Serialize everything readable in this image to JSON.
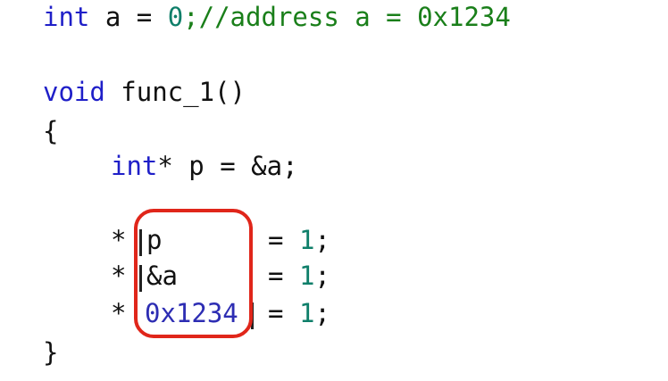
{
  "code": {
    "line1": {
      "kw": "int",
      "rest": " a = ",
      "num": "0",
      "semi": ";",
      "comment": "//address a = 0x1234"
    },
    "line2": {
      "kw": "void",
      "rest": " func_1()"
    },
    "line3": {
      "text": "{"
    },
    "line4": {
      "kw": "int",
      "rest": "* p = &a;"
    },
    "line5": {
      "star": "*",
      "operand": "p",
      "eq": "=",
      "num": "1",
      "semi": ";"
    },
    "line6": {
      "star": "*",
      "operand": "&a",
      "eq": "=",
      "num": "1",
      "semi": ";"
    },
    "line7": {
      "star": "*",
      "operand": "0x1234",
      "eq": "=",
      "num": "1",
      "semi": ";"
    },
    "line8": {
      "text": "}"
    }
  },
  "colors": {
    "keyword": "#1f1fc8",
    "number": "#0f7f6a",
    "comment": "#1a7f1a",
    "hex_literal": "#2d2db3",
    "highlight_border": "#e0261a",
    "text": "#111111"
  }
}
